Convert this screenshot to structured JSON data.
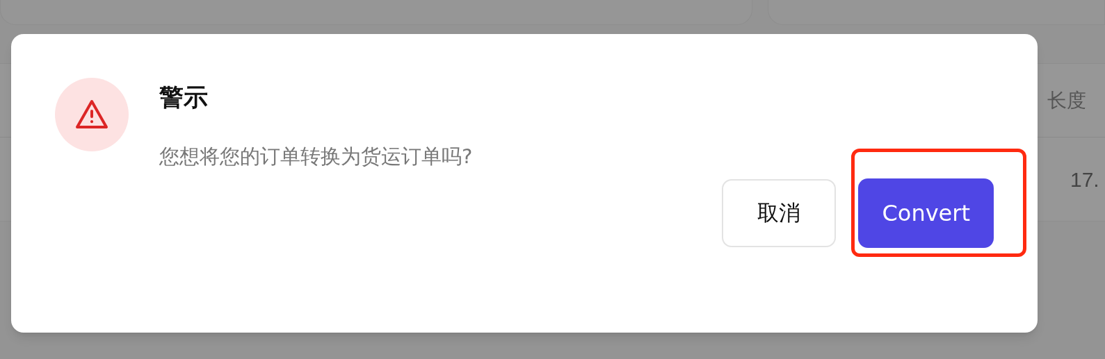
{
  "background": {
    "table": {
      "column_header": "长度",
      "cell": "17."
    }
  },
  "dialog": {
    "title": "警示",
    "message": "您想将您的订单转换为货运订单吗?",
    "buttons": [
      {
        "label": "取消",
        "kind": "secondary",
        "highlighted": false
      },
      {
        "label": "Convert",
        "kind": "primary",
        "highlighted": true
      }
    ]
  }
}
